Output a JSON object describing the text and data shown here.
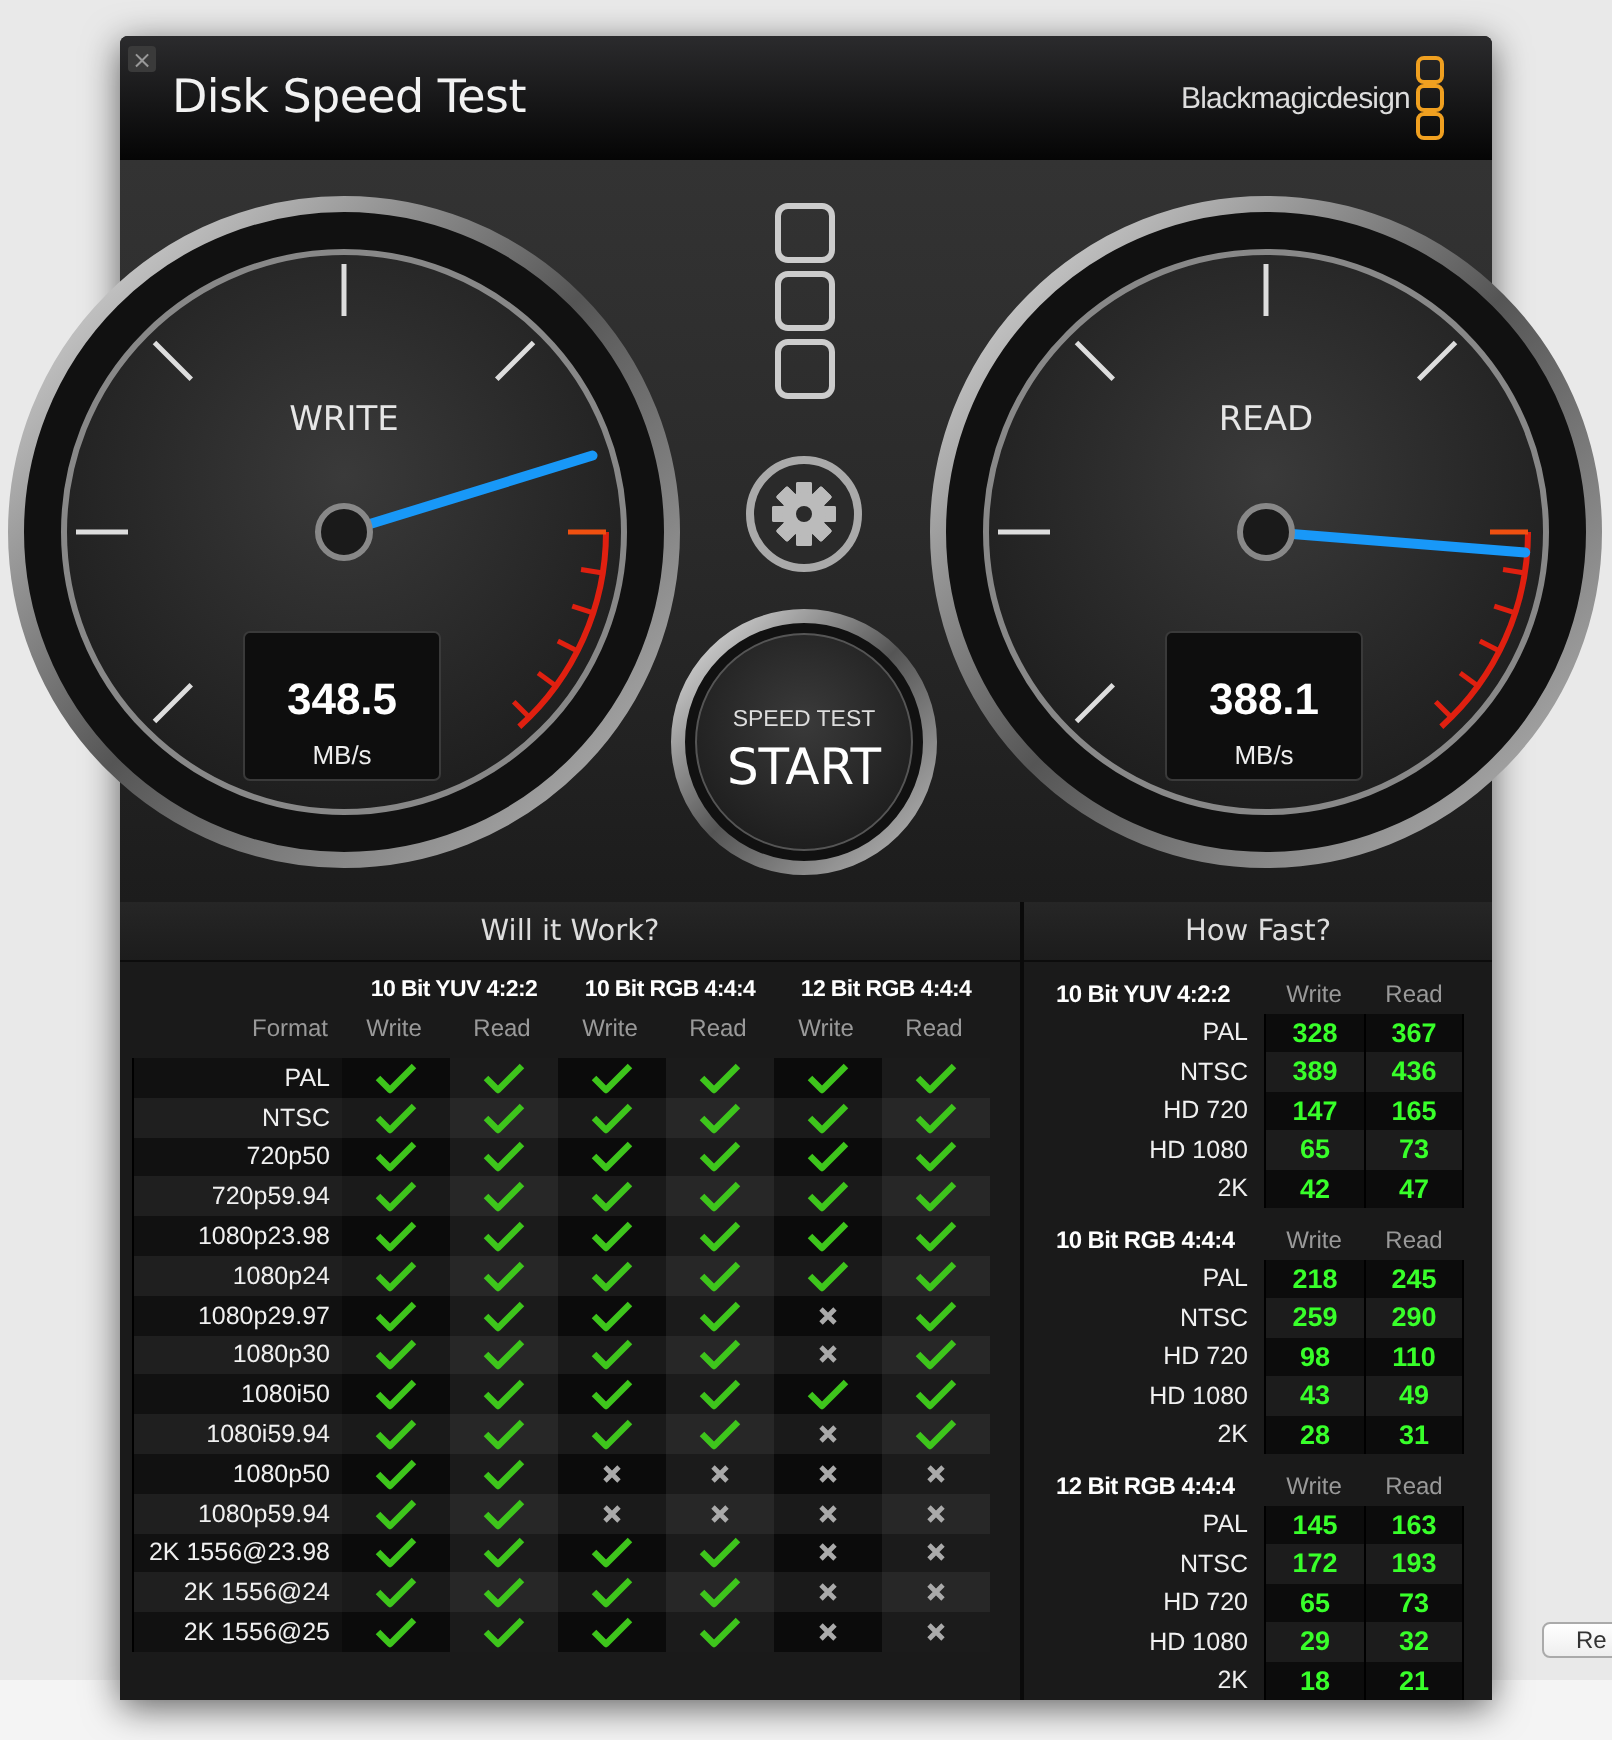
{
  "window": {
    "close": "×",
    "title": "Disk Speed Test",
    "brand": "Blackmagicdesign"
  },
  "gauges": [
    {
      "label": "WRITE",
      "level": 0.77,
      "reading": "348.5",
      "unit": "MB/s"
    },
    {
      "label": "READ",
      "level": 0.85,
      "reading": "388.1",
      "unit": "MB/s"
    }
  ],
  "start_button": {
    "caption": "SPEED TEST",
    "label": "START"
  },
  "will_it_work": {
    "title": "Will it Work?",
    "format_label": "Format",
    "groups": [
      {
        "name": "10 Bit YUV 4:2:2",
        "columns": [
          "Write",
          "Read"
        ]
      },
      {
        "name": "10 Bit RGB 4:4:4",
        "columns": [
          "Write",
          "Read"
        ]
      },
      {
        "name": "12 Bit RGB 4:4:4",
        "columns": [
          "Write",
          "Read"
        ]
      }
    ],
    "rows": [
      {
        "format": "PAL",
        "works": [
          true,
          true,
          true,
          true,
          true,
          true
        ]
      },
      {
        "format": "NTSC",
        "works": [
          true,
          true,
          true,
          true,
          true,
          true
        ]
      },
      {
        "format": "720p50",
        "works": [
          true,
          true,
          true,
          true,
          true,
          true
        ]
      },
      {
        "format": "720p59.94",
        "works": [
          true,
          true,
          true,
          true,
          true,
          true
        ]
      },
      {
        "format": "1080p23.98",
        "works": [
          true,
          true,
          true,
          true,
          true,
          true
        ]
      },
      {
        "format": "1080p24",
        "works": [
          true,
          true,
          true,
          true,
          true,
          true
        ]
      },
      {
        "format": "1080p29.97",
        "works": [
          true,
          true,
          true,
          true,
          false,
          true
        ]
      },
      {
        "format": "1080p30",
        "works": [
          true,
          true,
          true,
          true,
          false,
          true
        ]
      },
      {
        "format": "1080i50",
        "works": [
          true,
          true,
          true,
          true,
          true,
          true
        ]
      },
      {
        "format": "1080i59.94",
        "works": [
          true,
          true,
          true,
          true,
          false,
          true
        ]
      },
      {
        "format": "1080p50",
        "works": [
          true,
          true,
          false,
          false,
          false,
          false
        ]
      },
      {
        "format": "1080p59.94",
        "works": [
          true,
          true,
          false,
          false,
          false,
          false
        ]
      },
      {
        "format": "2K 1556@23.98",
        "works": [
          true,
          true,
          true,
          true,
          false,
          false
        ]
      },
      {
        "format": "2K 1556@24",
        "works": [
          true,
          true,
          true,
          true,
          false,
          false
        ]
      },
      {
        "format": "2K 1556@25",
        "works": [
          true,
          true,
          true,
          true,
          false,
          false
        ]
      }
    ]
  },
  "how_fast": {
    "title": "How Fast?",
    "groups": [
      {
        "name": "10 Bit YUV 4:2:2",
        "columns": [
          "Write",
          "Read"
        ],
        "rows": [
          {
            "format": "PAL",
            "values": [
              "328",
              "367"
            ]
          },
          {
            "format": "NTSC",
            "values": [
              "389",
              "436"
            ]
          },
          {
            "format": "HD 720",
            "values": [
              "147",
              "165"
            ]
          },
          {
            "format": "HD 1080",
            "values": [
              "65",
              "73"
            ]
          },
          {
            "format": "2K",
            "values": [
              "42",
              "47"
            ]
          }
        ]
      },
      {
        "name": "10 Bit RGB 4:4:4",
        "columns": [
          "Write",
          "Read"
        ],
        "rows": [
          {
            "format": "PAL",
            "values": [
              "218",
              "245"
            ]
          },
          {
            "format": "NTSC",
            "values": [
              "259",
              "290"
            ]
          },
          {
            "format": "HD 720",
            "values": [
              "98",
              "110"
            ]
          },
          {
            "format": "HD 1080",
            "values": [
              "43",
              "49"
            ]
          },
          {
            "format": "2K",
            "values": [
              "28",
              "31"
            ]
          }
        ]
      },
      {
        "name": "12 Bit RGB 4:4:4",
        "columns": [
          "Write",
          "Read"
        ],
        "rows": [
          {
            "format": "PAL",
            "values": [
              "145",
              "163"
            ]
          },
          {
            "format": "NTSC",
            "values": [
              "172",
              "193"
            ]
          },
          {
            "format": "HD 720",
            "values": [
              "65",
              "73"
            ]
          },
          {
            "format": "HD 1080",
            "values": [
              "29",
              "32"
            ]
          },
          {
            "format": "2K",
            "values": [
              "18",
              "21"
            ]
          }
        ]
      }
    ]
  },
  "background": {
    "button": "Re"
  }
}
